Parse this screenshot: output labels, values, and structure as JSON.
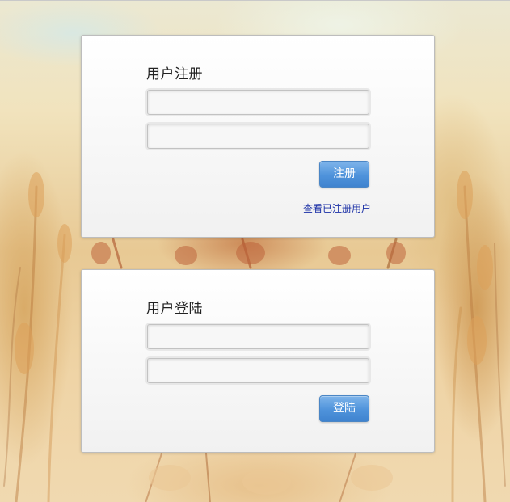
{
  "register": {
    "title": "用户注册",
    "username_value": "",
    "password_value": "",
    "submit_label": "注册",
    "view_users_link": "查看已注册用户"
  },
  "login": {
    "title": "用户登陆",
    "username_value": "",
    "password_value": "",
    "submit_label": "登陆"
  },
  "colors": {
    "button_blue": "#4f93db",
    "link_blue": "#1a2fa6"
  }
}
